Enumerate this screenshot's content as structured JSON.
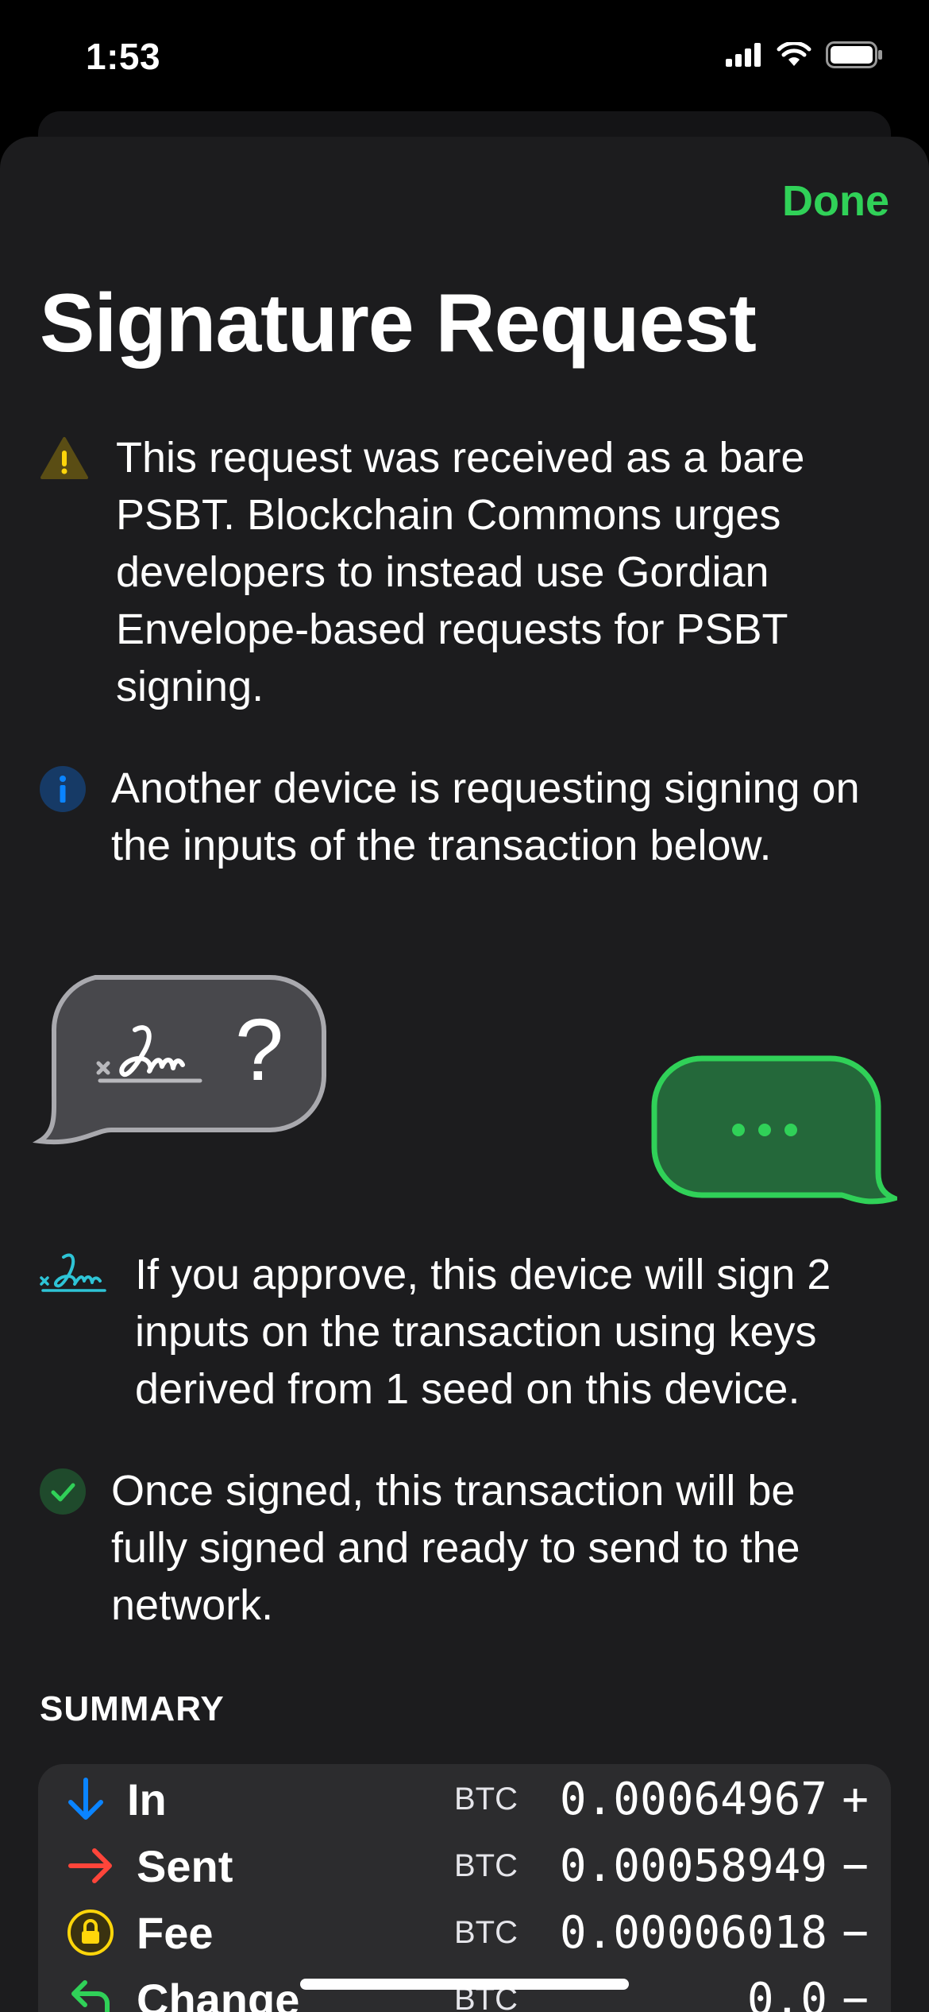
{
  "status_bar": {
    "time": "1:53"
  },
  "header": {
    "done_label": "Done",
    "title": "Signature Request"
  },
  "notes": [
    {
      "icon": "warning-icon",
      "text": "This request was received as a bare PSBT. Blockchain Commons urges developers to instead use Gordian Envelope-based requests for PSBT signing."
    },
    {
      "icon": "info-icon",
      "text": "Another device is requesting signing on the inputs of the transaction below."
    },
    {
      "icon": "signature-icon",
      "text": "If you approve, this device will sign 2 inputs on the transaction using keys derived from 1 seed on this device."
    },
    {
      "icon": "checkmark-icon",
      "text": "Once signed, this transaction will be fully signed and ready to send to the network."
    }
  ],
  "illustration": {
    "request_glyph": "?"
  },
  "summary": {
    "header": "SUMMARY",
    "rows": [
      {
        "icon": "arrow-down-icon",
        "label": "In",
        "unit": "BTC",
        "amount": "0.00064967",
        "sign": "+"
      },
      {
        "icon": "arrow-right-icon",
        "label": "Sent",
        "unit": "BTC",
        "amount": "0.00058949",
        "sign": "−"
      },
      {
        "icon": "lock-icon",
        "label": "Fee",
        "unit": "BTC",
        "amount": "0.00006018",
        "sign": "−"
      },
      {
        "icon": "return-arrow-icon",
        "label": "Change",
        "unit": "BTC",
        "amount": "0.0",
        "sign": "−"
      }
    ]
  },
  "colors": {
    "accent_green": "#30d158",
    "warning_yellow": "#ffd60a",
    "info_blue": "#0a84ff",
    "arrow_red": "#ff453a",
    "signature_teal": "#2ec4d6"
  }
}
